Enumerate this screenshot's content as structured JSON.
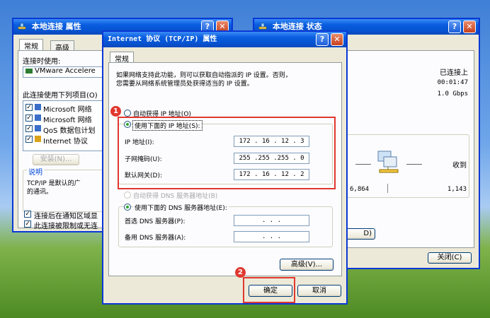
{
  "left_window": {
    "title": "本地连接 属性",
    "tabs": [
      "常规",
      "高级"
    ],
    "connect_using_label": "连接时使用:",
    "adapter": "VMware Accelere",
    "items_label": "此连接使用下列项目(O)",
    "items": [
      "Microsoft 网络",
      "Microsoft 网络",
      "QoS 数据包计划",
      "Internet 协议"
    ],
    "install_button": "安装(N)...",
    "description_label": "说明",
    "description_text": "TCP/IP 是默认的广域网协议。它提供跨越多种互联网的通讯。",
    "desc_line1": "TCP/IP 是默认的广",
    "desc_line2": "的通讯。",
    "checkbox1": "连接后在通知区域显",
    "checkbox2": "此连接被限制或无连"
  },
  "status_window": {
    "title": "本地连接 状态",
    "status": "已连接上",
    "duration": "00:01:47",
    "speed": "1.0 Gbps",
    "received_label": "收到",
    "sent_value": "6,864",
    "received_value": "1,143",
    "close_button": "关闭(C)",
    "partial_button": "D)"
  },
  "tcpip_dialog": {
    "title": "Internet 协议 (TCP/IP) 属性",
    "tab": "常规",
    "intro_line1": "如果网络支持此功能，则可以获取自动指派的 IP 设置。否则，",
    "intro_line2": "您需要从网络系统管理员处获得适当的 IP 设置。",
    "auto_ip": "自动获得 IP 地址(O)",
    "manual_ip": "使用下面的 IP 地址(S):",
    "ip_label": "IP 地址(I):",
    "mask_label": "子网掩码(U):",
    "gateway_label": "默认网关(D):",
    "ip_value": "172 . 16 . 12 . 3",
    "mask_value": "255 .255 .255 . 0",
    "gateway_value": "172 . 16 . 12 . 2",
    "auto_dns": "自动获得 DNS 服务器地址(B)",
    "manual_dns": "使用下面的 DNS 服务器地址(E):",
    "preferred_dns_label": "首选 DNS 服务器(P):",
    "alternate_dns_label": "备用 DNS 服务器(A):",
    "preferred_dns_value": ".     .     .",
    "alternate_dns_value": ".     .     .",
    "advanced_button": "高级(V)...",
    "ok_button": "确定",
    "cancel_button": "取消"
  },
  "annotations": {
    "badge1": "1",
    "badge2": "2"
  },
  "colors": {
    "annotation_red": "#e0382f",
    "title_blue": "#0a5ee0"
  }
}
